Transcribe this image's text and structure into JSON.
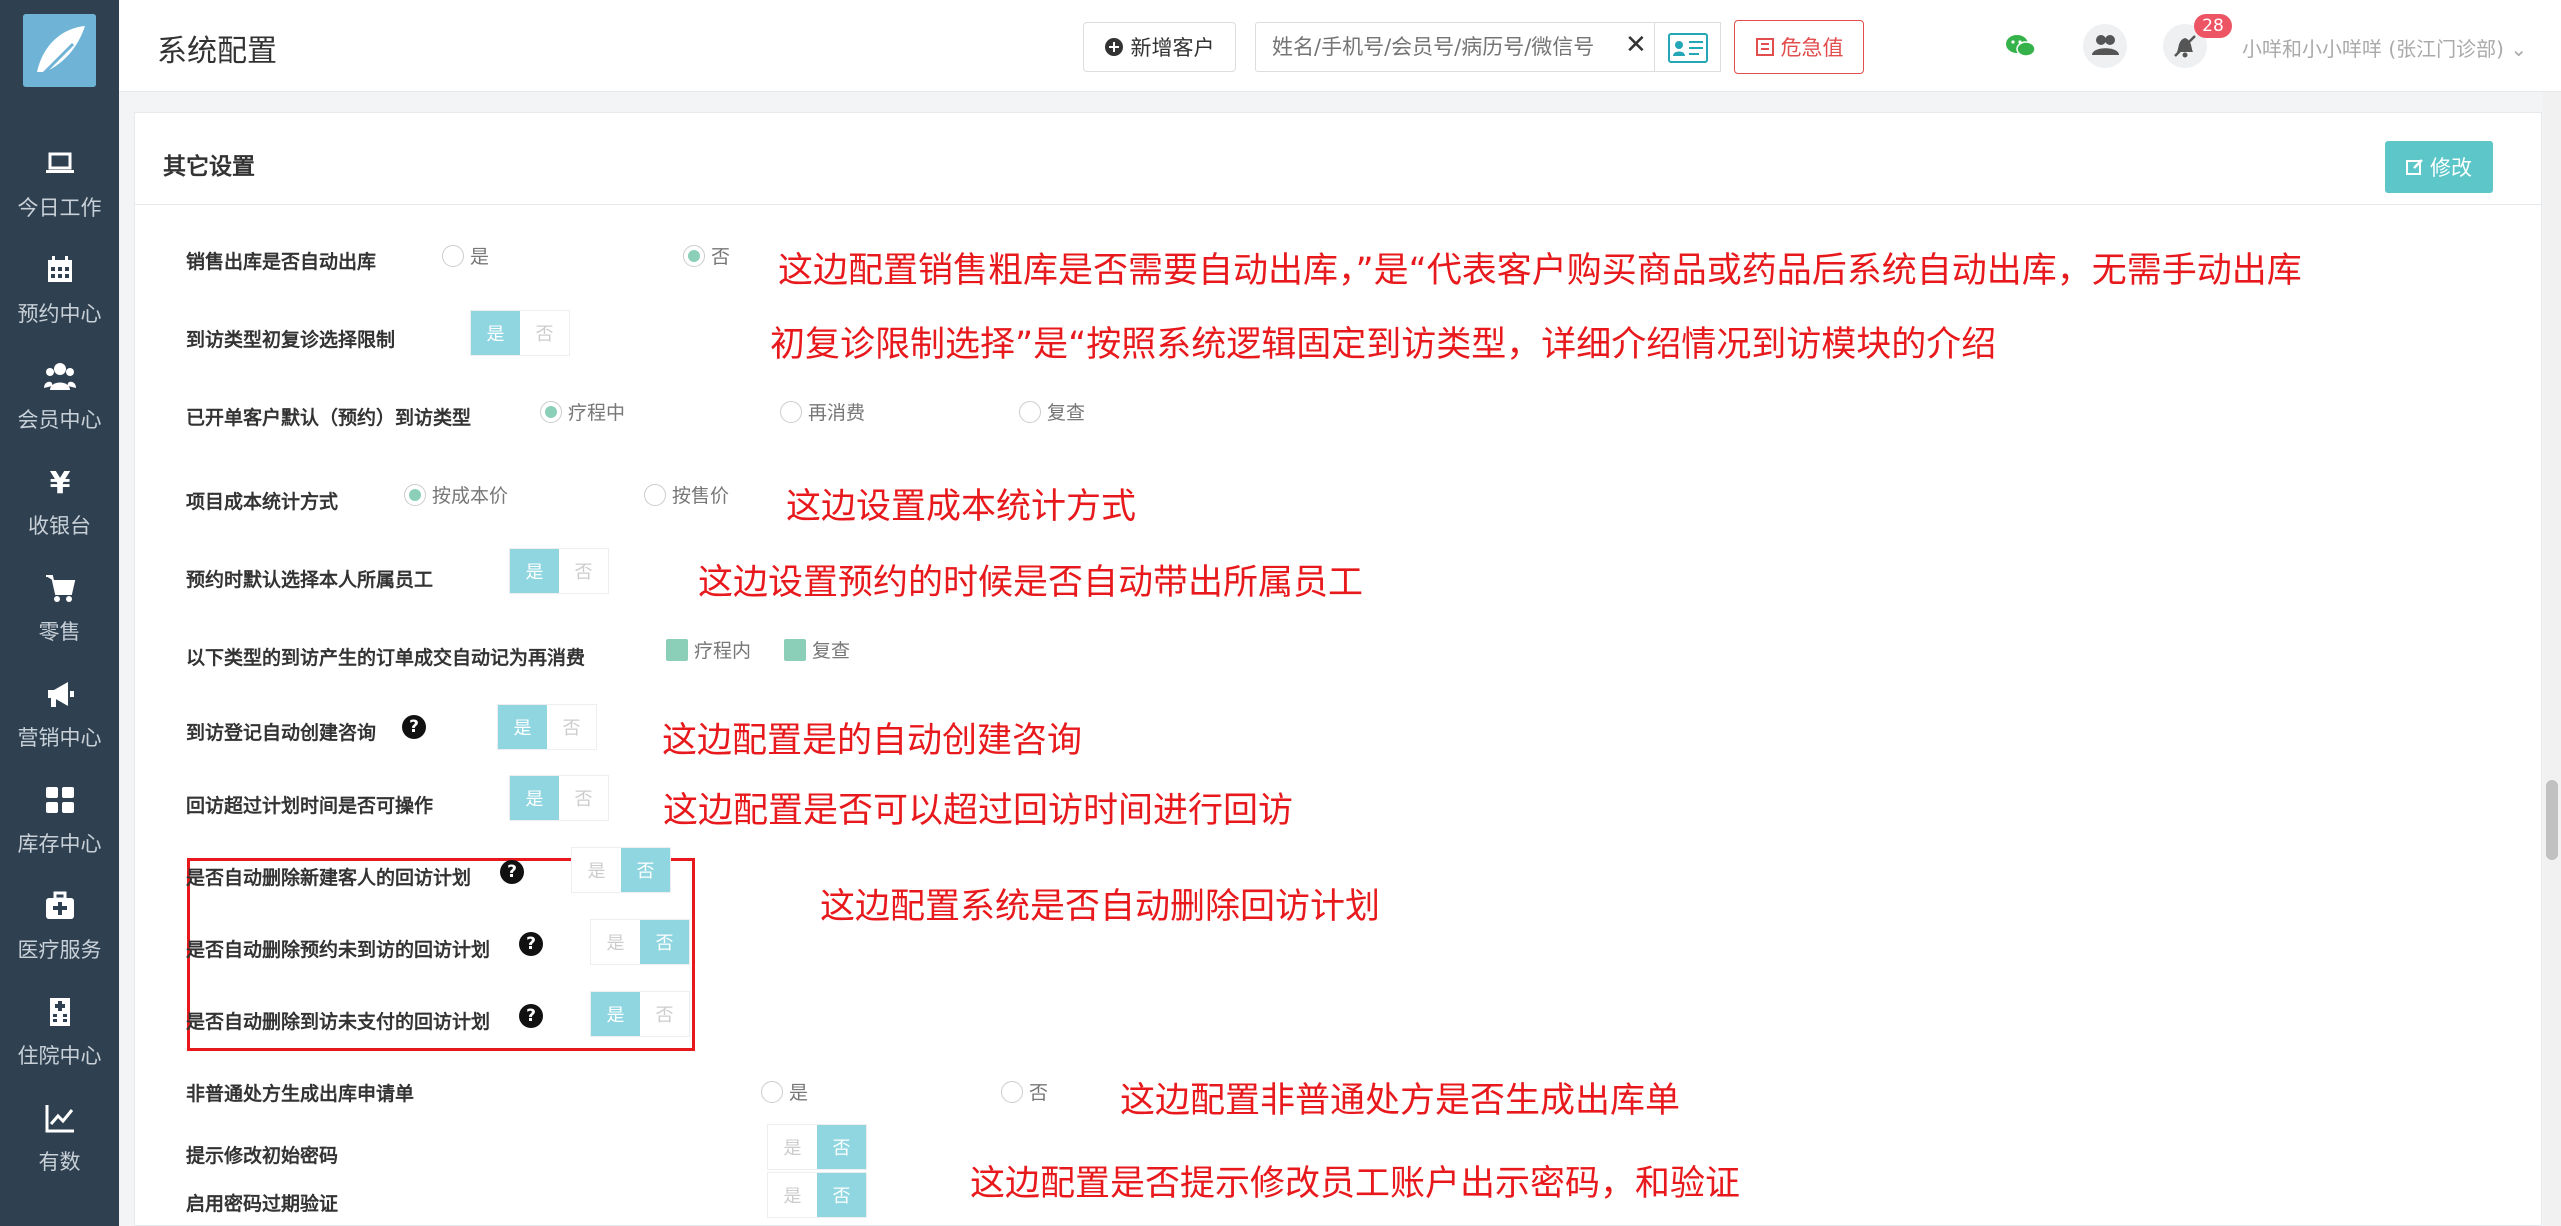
{
  "sidebar": {
    "items": [
      {
        "label": "今日工作",
        "icon": "laptop-icon"
      },
      {
        "label": "预约中心",
        "icon": "calendar-icon"
      },
      {
        "label": "会员中心",
        "icon": "users-icon"
      },
      {
        "label": "收银台",
        "icon": "yen-icon"
      },
      {
        "label": "零售",
        "icon": "cart-icon"
      },
      {
        "label": "营销中心",
        "icon": "megaphone-icon"
      },
      {
        "label": "库存中心",
        "icon": "grid-icon"
      },
      {
        "label": "医疗服务",
        "icon": "medkit-icon"
      },
      {
        "label": "住院中心",
        "icon": "hospital-icon"
      },
      {
        "label": "有数",
        "icon": "chart-line-icon"
      }
    ]
  },
  "header": {
    "title": "系统配置",
    "add_customer": "新增客户",
    "search_placeholder": "姓名/手机号/会员号/病历号/微信号",
    "clear": "✕",
    "danger_value": "危急值",
    "notification_count": "28",
    "user": "小咩和小小咩咩 (张江门诊部)"
  },
  "panel": {
    "title": "其它设置",
    "edit": "修改"
  },
  "options": {
    "yes": "是",
    "no": "否",
    "in_course": "疗程中",
    "reconsume": "再消费",
    "review": "复查",
    "by_cost": "按成本价",
    "by_price": "按售价",
    "in_course2": "疗程内"
  },
  "rows": {
    "r1": "销售出库是否自动出库",
    "r2": "到访类型初复诊选择限制",
    "r3": "已开单客户默认（预约）到访类型",
    "r4": "项目成本统计方式",
    "r5": "预约时默认选择本人所属员工",
    "r6": "以下类型的到访产生的订单成交自动记为再消费",
    "r7": "到访登记自动创建咨询",
    "r8": "回访超过计划时间是否可操作",
    "r9": "是否自动删除新建客人的回访计划",
    "r10": "是否自动删除预约未到访的回访计划",
    "r11": "是否自动删除到访未支付的回访计划",
    "r12": "非普通处方生成出库申请单",
    "r13": "提示修改初始密码",
    "r14": "启用密码过期验证"
  },
  "notes": {
    "n1": "这边配置销售粗库是否需要自动出库，”是“代表客户购买商品或药品后系统自动出库，无需手动出库",
    "n2": "初复诊限制选择”是“按照系统逻辑固定到访类型，详细介绍情况到访模块的介绍",
    "n3": "这边设置成本统计方式",
    "n4": "这边设置预约的时候是否自动带出所属员工",
    "n5": "这边配置是的自动创建咨询",
    "n6": "这边配置是否可以超过回访时间进行回访",
    "n7": "这边配置系统是否自动删除回访计划",
    "n8": "这边配置非普通处方是否生成出库单",
    "n9": "这边配置是否提示修改员工账户出示密码，和验证"
  },
  "colors": {
    "sidebar_bg": "#2f4050",
    "accent": "#5cc6c8",
    "annotation": "#e8191c",
    "toggle_on": "#8fd6e0"
  }
}
